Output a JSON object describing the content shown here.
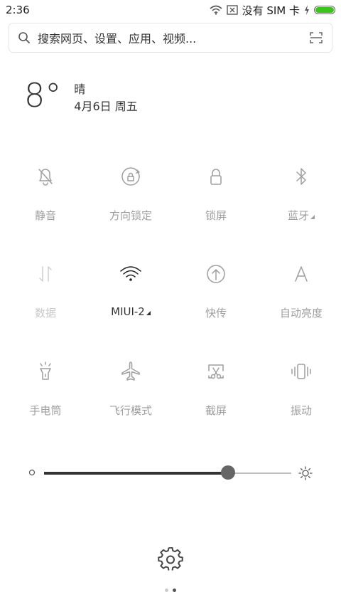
{
  "status": {
    "time": "2:36",
    "carrier": "没有 SIM 卡",
    "battery_level": 1.0,
    "battery_color": "#3ec21e"
  },
  "search": {
    "placeholder": "搜索网页、设置、应用、视频..."
  },
  "weather": {
    "temp": "8°",
    "condition": "晴",
    "date": "4月6日 周五"
  },
  "tiles": [
    {
      "label": "静音",
      "icon": "bell-off-icon",
      "state": "off"
    },
    {
      "label": "方向锁定",
      "icon": "rotation-lock-icon",
      "state": "off"
    },
    {
      "label": "锁屏",
      "icon": "lock-icon",
      "state": "off"
    },
    {
      "label": "蓝牙",
      "icon": "bluetooth-icon",
      "state": "off",
      "has_more": true
    },
    {
      "label": "数据",
      "icon": "data-arrows-icon",
      "state": "disabled"
    },
    {
      "label": "MIUI-2",
      "icon": "wifi-icon",
      "state": "active",
      "has_more": true
    },
    {
      "label": "快传",
      "icon": "upload-circle-icon",
      "state": "off"
    },
    {
      "label": "自动亮度",
      "icon": "auto-brightness-icon",
      "state": "off"
    },
    {
      "label": "手电筒",
      "icon": "flashlight-icon",
      "state": "off"
    },
    {
      "label": "飞行模式",
      "icon": "airplane-icon",
      "state": "off"
    },
    {
      "label": "截屏",
      "icon": "screenshot-icon",
      "state": "off"
    },
    {
      "label": "振动",
      "icon": "vibrate-icon",
      "state": "off"
    }
  ],
  "brightness": {
    "level": 0.745
  },
  "pager": {
    "count": 2,
    "current": 2
  }
}
